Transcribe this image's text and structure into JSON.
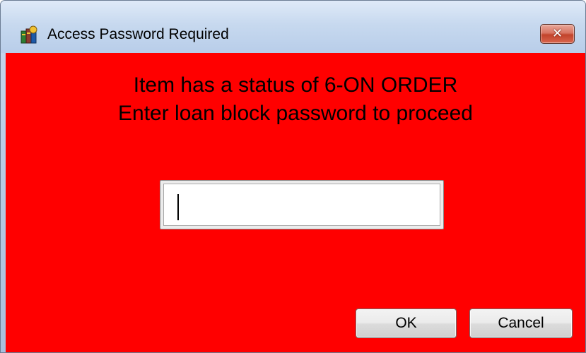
{
  "window": {
    "title": "Access Password Required",
    "close_label": "✕"
  },
  "message": {
    "line1": "Item has a status of 6-ON ORDER",
    "line2": "Enter loan block password to proceed"
  },
  "password": {
    "value": "",
    "placeholder": ""
  },
  "buttons": {
    "ok_label": "OK",
    "cancel_label": "Cancel"
  },
  "colors": {
    "background": "#ff0000",
    "titlebar": "#c7d9ef",
    "close_button": "#c2432b"
  },
  "icons": {
    "app_icon": "library-books-icon",
    "close_icon": "close-icon"
  }
}
